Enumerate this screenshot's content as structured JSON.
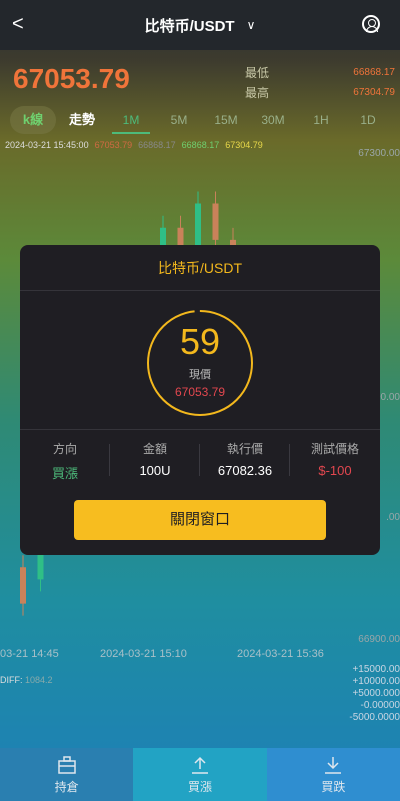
{
  "header": {
    "back": "<",
    "title": "比特币/USDT",
    "chevron": "∨"
  },
  "ticker": {
    "price": "67053.79",
    "low_label": "最低",
    "low_value": "66868.17",
    "high_label": "最高",
    "high_value": "67304.79"
  },
  "tabs": {
    "kline": "k線",
    "trend": "走勢",
    "intervals": [
      "1M",
      "5M",
      "15M",
      "30M",
      "1H",
      "1D"
    ],
    "active": "1M"
  },
  "legend": {
    "time": "2024-03-21 15:45:00",
    "v1": "67053.79",
    "v2": "66868.17",
    "v3": "66868.17",
    "v4": "67304.79"
  },
  "axis": {
    "top": "67300.00",
    "bottom": "66900.00",
    "mid": "00.00",
    "mid2": ".00",
    "times": [
      "03-21 14:45",
      "2024-03-21 15:10",
      "2024-03-21 15:36"
    ],
    "macd": [
      "+15000.00",
      "+10000.00",
      "+5000.000",
      "-0.00000",
      "-5000.0000"
    ],
    "diff_label": "DIFF: ",
    "diff_val": "1084.2"
  },
  "colors": {
    "up": "#2fbf86",
    "down": "#c9825a",
    "accent": "#f3b81d",
    "red": "#e2474f",
    "green": "#4dbb7b"
  },
  "modal": {
    "title": "比特币/USDT",
    "countdown": "59",
    "current_label": "現價",
    "current_price": "67053.79",
    "direction_label": "方向",
    "direction_value": "買漲",
    "amount_label": "金額",
    "amount_value": "100U",
    "exec_label": "執行價",
    "exec_value": "67082.36",
    "test_label": "測試價格",
    "test_value": "$-100",
    "close": "關閉窗口"
  },
  "footer": {
    "hold": "持倉",
    "buy": "買漲",
    "sell": "買跌"
  },
  "chart_data": {
    "type": "bar",
    "candles": [
      {
        "o": 66960,
        "c": 66930
      },
      {
        "o": 66950,
        "c": 66990
      },
      {
        "o": 66990,
        "c": 67040
      },
      {
        "o": 67040,
        "c": 67010
      },
      {
        "o": 67010,
        "c": 67060
      },
      {
        "o": 67060,
        "c": 67120
      },
      {
        "o": 67120,
        "c": 67100
      },
      {
        "o": 67100,
        "c": 67180
      },
      {
        "o": 67180,
        "c": 67240
      },
      {
        "o": 67240,
        "c": 67200
      },
      {
        "o": 67200,
        "c": 67260
      },
      {
        "o": 67260,
        "c": 67230
      },
      {
        "o": 67230,
        "c": 67180
      },
      {
        "o": 67180,
        "c": 67120
      },
      {
        "o": 67120,
        "c": 67150
      },
      {
        "o": 67150,
        "c": 67090
      }
    ],
    "ylim": [
      66900,
      67300
    ]
  }
}
